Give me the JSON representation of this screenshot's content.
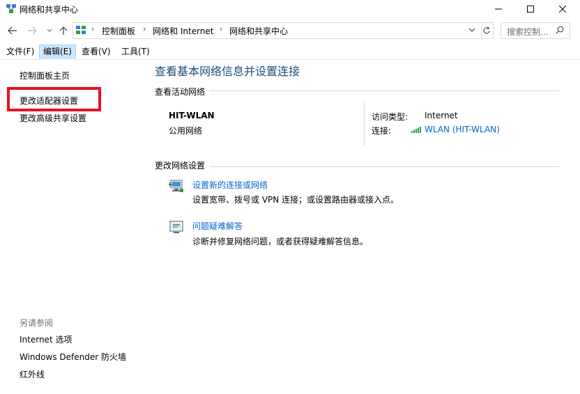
{
  "window": {
    "title": "网络和共享中心"
  },
  "address": {
    "crumbs": [
      "控制面板",
      "网络和 Internet",
      "网络和共享中心"
    ],
    "search_placeholder": "搜索控制..."
  },
  "menu": {
    "items": [
      "文件(F)",
      "编辑(E)",
      "查看(V)",
      "工具(T)"
    ],
    "active_index": 1
  },
  "sidebar": {
    "home": "控制面板主页",
    "links": [
      "更改适配器设置",
      "更改高级共享设置"
    ],
    "see_also_label": "另请参阅",
    "see_also": [
      "Internet 选项",
      "Windows Defender 防火墙",
      "红外线"
    ]
  },
  "main": {
    "title": "查看基本网络信息并设置连接",
    "active_networks_label": "查看活动网络",
    "network": {
      "name": "HIT-WLAN",
      "category": "公用网络",
      "access_type_label": "访问类型:",
      "access_type_value": "Internet",
      "connection_label": "连接:",
      "connection_value": "WLAN (HIT-WLAN)"
    },
    "change_settings_label": "更改网络设置",
    "tasks": [
      {
        "title": "设置新的连接或网络",
        "desc": "设置宽带、拨号或 VPN 连接；或设置路由器或接入点。",
        "icon": "new-connection-icon"
      },
      {
        "title": "问题疑难解答",
        "desc": "诊断并修复网络问题，或者获得疑难解答信息。",
        "icon": "troubleshoot-icon"
      }
    ]
  },
  "colors": {
    "link": "#0066cc",
    "title": "#1e4e79",
    "highlight": "#e81123",
    "menu_active": "#cce8ff"
  }
}
